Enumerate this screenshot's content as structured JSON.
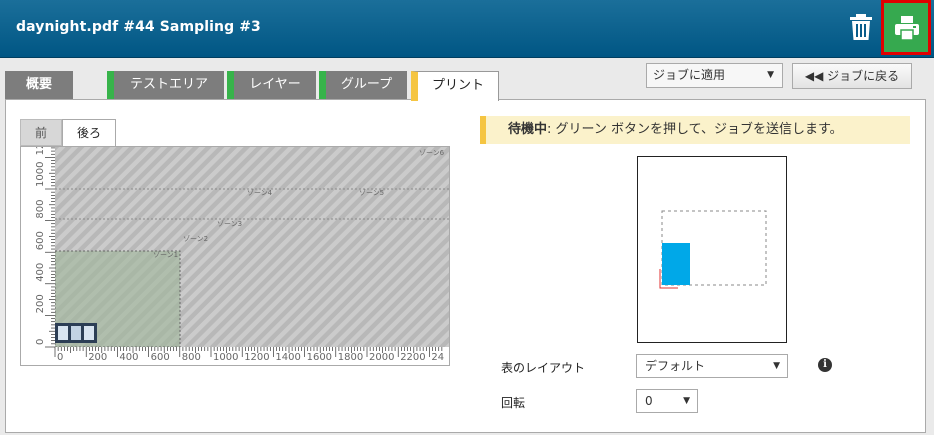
{
  "header": {
    "title": "daynight.pdf #44 Sampling #3"
  },
  "tabs": [
    {
      "label": "概要"
    },
    {
      "label": "テストエリア"
    },
    {
      "label": "レイヤー"
    },
    {
      "label": "グループ"
    },
    {
      "label": "プリント"
    }
  ],
  "toolbar": {
    "apply_select": "ジョブに適用",
    "back_button": "◀◀ ジョブに戻る"
  },
  "preview": {
    "side_tabs": [
      "前",
      "後ろ"
    ],
    "x_ticks": [
      "0",
      "200",
      "400",
      "600",
      "800",
      "1000",
      "1200",
      "1400",
      "1600",
      "1800",
      "2000",
      "2200",
      "24"
    ],
    "y_ticks": [
      "0",
      "200",
      "400",
      "600",
      "800",
      "1000",
      "1200"
    ],
    "zones": [
      "ゾーン1",
      "ゾーン2",
      "ゾーン3",
      "ゾーン4",
      "ゾーン5",
      "ゾーン6"
    ]
  },
  "status": {
    "label": "待機中",
    "message": ": グリーン ボタンを押して、ジョブを送信します。"
  },
  "form": {
    "layout_label": "表のレイアウト",
    "layout_value": "デフォルト",
    "rotation_label": "回転",
    "rotation_value": "0"
  },
  "colors": {
    "header": "#005684",
    "print_button": "#36a94f",
    "print_highlight": "#e00000",
    "accent_green": "#37b34a",
    "accent_yellow": "#f5c542",
    "preview_blue": "#00a8e8"
  },
  "icons": {
    "trash": "trash-icon",
    "print": "printer-icon",
    "info": "info-icon"
  }
}
